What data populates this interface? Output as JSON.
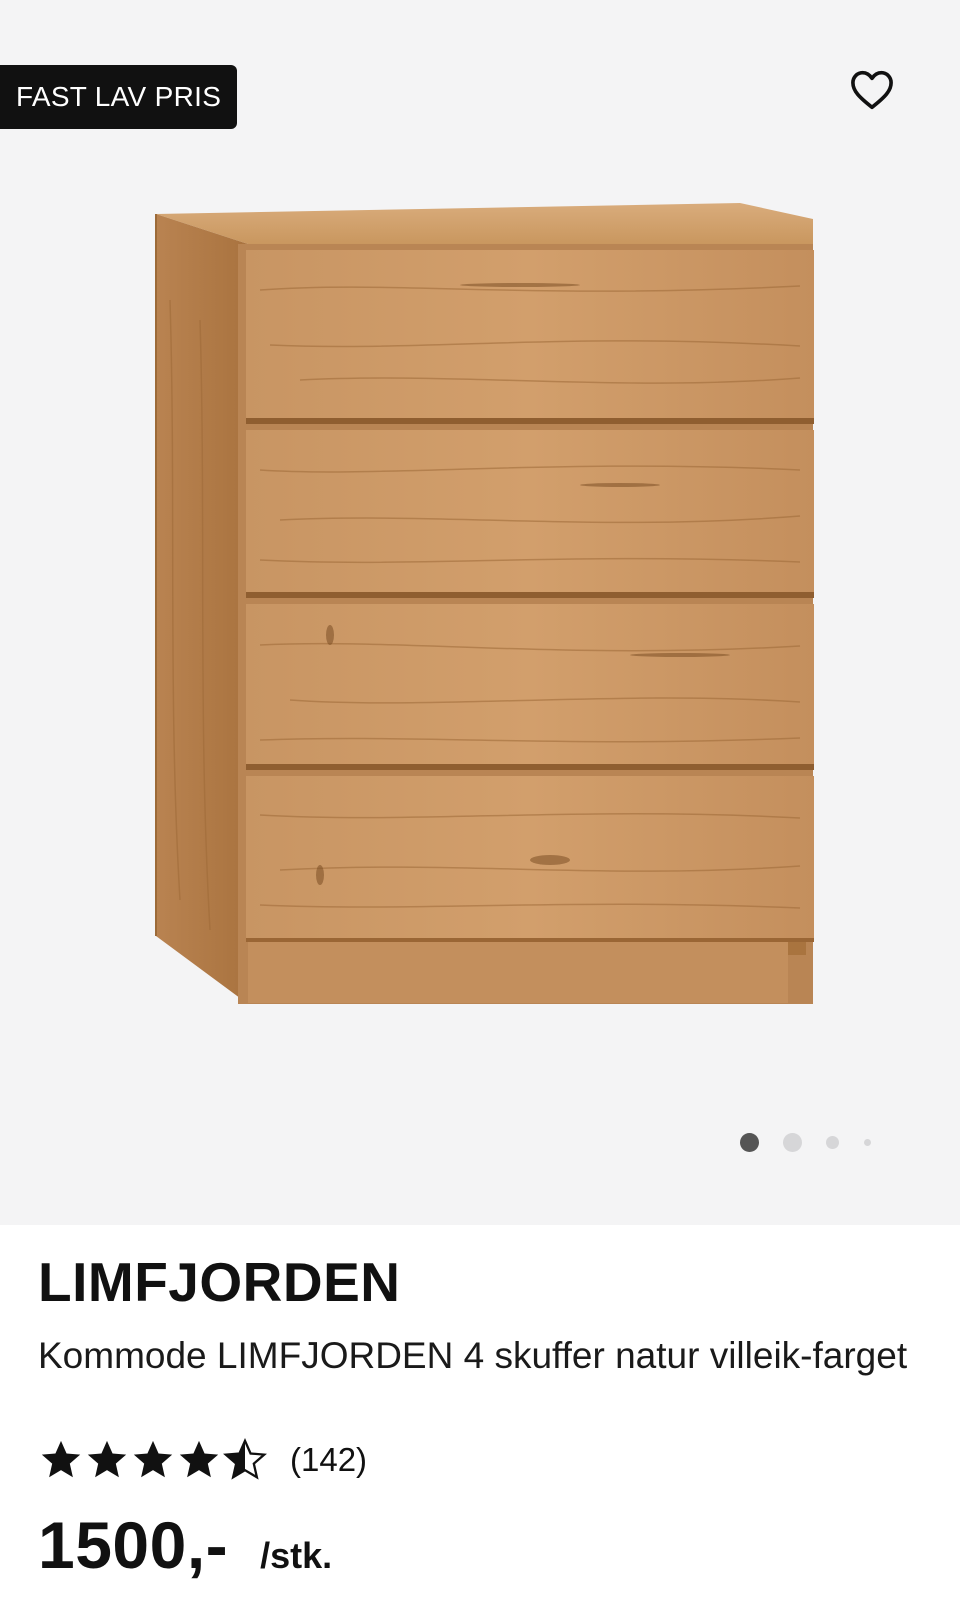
{
  "gallery": {
    "badge": "FAST LAV PRIS",
    "favorite_icon": "heart-outline-icon",
    "image_alt": "Kommode LIMFJORDEN 4 skuffer",
    "slides_total": 4,
    "active_slide": 1
  },
  "product": {
    "brand": "LIMFJORDEN",
    "description": "Kommode LIMFJORDEN 4 skuffer natur villeik-farget",
    "rating_value": 4.5,
    "rating_max": 5,
    "rating_count": "(142)",
    "price": "1500,-",
    "unit": "/stk."
  },
  "colors": {
    "wood": "#c38f5d",
    "badge_bg": "#111111",
    "gallery_bg": "#f4f4f5"
  }
}
